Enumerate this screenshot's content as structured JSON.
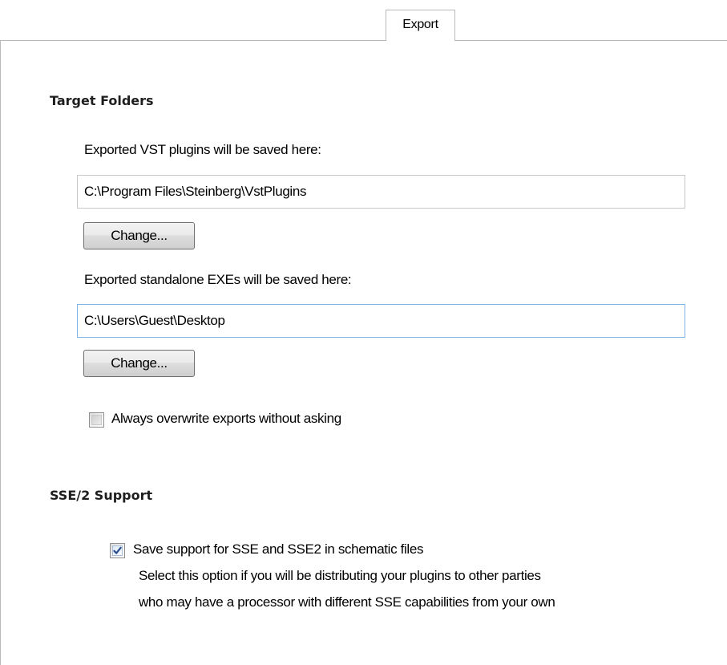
{
  "tabs": [
    {
      "label": "Export",
      "active": true
    }
  ],
  "target_folders": {
    "heading": "Target Folders",
    "vst": {
      "label": "Exported VST plugins will be saved here:",
      "value": "C:\\Program Files\\Steinberg\\VstPlugins",
      "button_label": "Change..."
    },
    "exe": {
      "label": "Exported standalone EXEs will be saved here:",
      "value": "C:\\Users\\Guest\\Desktop",
      "button_label": "Change..."
    },
    "overwrite": {
      "label": "Always overwrite exports without asking",
      "checked": false
    }
  },
  "sse": {
    "heading": "SSE/2 Support",
    "option": {
      "label": "Save support for SSE and SSE2 in schematic files",
      "checked": true,
      "description_line1": "Select this option if you will be distributing your plugins to other parties",
      "description_line2": "who may have a processor with different SSE capabilities from your own"
    }
  },
  "colors": {
    "check_mark": "#2a4d8f",
    "focus_border": "#7eb4ea",
    "tab_border": "#b9b9b9"
  },
  "icons": {
    "check": "check-mark-icon"
  }
}
